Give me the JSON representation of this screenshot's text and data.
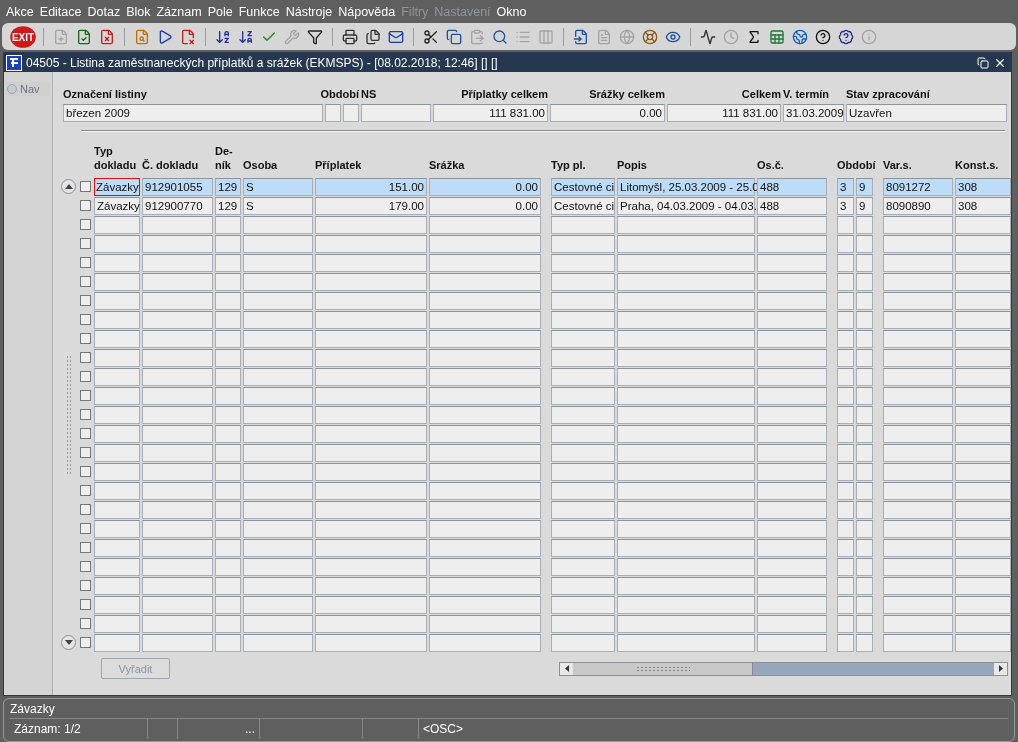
{
  "menu": [
    {
      "label": "Akce",
      "disabled": false
    },
    {
      "label": "Editace",
      "disabled": false
    },
    {
      "label": "Dotaz",
      "disabled": false
    },
    {
      "label": "Blok",
      "disabled": false
    },
    {
      "label": "Záznam",
      "disabled": false
    },
    {
      "label": "Pole",
      "disabled": false
    },
    {
      "label": "Funkce",
      "disabled": false
    },
    {
      "label": "Nástroje",
      "disabled": false
    },
    {
      "label": "Nápověda",
      "disabled": false
    },
    {
      "label": "Filtry",
      "disabled": true
    },
    {
      "label": "Nastavení",
      "disabled": true
    },
    {
      "label": "Okno",
      "disabled": false
    }
  ],
  "toolbar": [
    {
      "kind": "exit",
      "label": "EXIT",
      "disabled": false
    },
    {
      "kind": "separator"
    },
    {
      "kind": "insert",
      "disabled": true
    },
    {
      "kind": "save",
      "disabled": false
    },
    {
      "kind": "delete",
      "disabled": false
    },
    {
      "kind": "separator"
    },
    {
      "kind": "query",
      "disabled": false
    },
    {
      "kind": "run",
      "disabled": false
    },
    {
      "kind": "cancel",
      "disabled": false
    },
    {
      "kind": "separator"
    },
    {
      "kind": "sort-asc",
      "disabled": false
    },
    {
      "kind": "sort-desc",
      "disabled": false
    },
    {
      "kind": "check",
      "disabled": false
    },
    {
      "kind": "wrench",
      "disabled": true
    },
    {
      "kind": "filter",
      "disabled": false
    },
    {
      "kind": "separator"
    },
    {
      "kind": "print",
      "disabled": false
    },
    {
      "kind": "print-all",
      "disabled": false
    },
    {
      "kind": "mail",
      "disabled": false
    },
    {
      "kind": "separator"
    },
    {
      "kind": "cut",
      "disabled": false
    },
    {
      "kind": "copy",
      "disabled": false
    },
    {
      "kind": "paste",
      "disabled": true
    },
    {
      "kind": "find",
      "disabled": false
    },
    {
      "kind": "list",
      "disabled": true
    },
    {
      "kind": "columns",
      "disabled": true
    },
    {
      "kind": "separator"
    },
    {
      "kind": "import",
      "disabled": false
    },
    {
      "kind": "document",
      "disabled": true
    },
    {
      "kind": "globe",
      "disabled": true
    },
    {
      "kind": "wheel",
      "disabled": false
    },
    {
      "kind": "eye",
      "disabled": false
    },
    {
      "kind": "separator"
    },
    {
      "kind": "chart",
      "disabled": false
    },
    {
      "kind": "clock",
      "disabled": true
    },
    {
      "kind": "sigma",
      "disabled": false
    },
    {
      "kind": "sheet",
      "disabled": false
    },
    {
      "kind": "browser",
      "disabled": false
    },
    {
      "kind": "help",
      "disabled": false
    },
    {
      "kind": "help-box",
      "disabled": false
    },
    {
      "kind": "info",
      "disabled": true
    }
  ],
  "window": {
    "title": "04505 - Listina zaměstnaneckých příplatků a srážek (EKMSPS) - [08.02.2018; 12:46] [] []"
  },
  "nav": {
    "label": "Nav",
    "selected": false
  },
  "header": {
    "labels": [
      "Označení listiny",
      "Období",
      "NS",
      "Příplatky celkem",
      "Srážky celkem",
      "Celkem",
      "V. termín",
      "Stav zpracování"
    ],
    "fields": [
      {
        "value": "březen 2009"
      },
      {
        "value": "111 831.00"
      },
      {
        "value": "0.00"
      },
      {
        "value": "111 831.00"
      },
      {
        "value": "31.03.2009"
      },
      {
        "value": "Uzavřen"
      }
    ]
  },
  "table": {
    "columns": [
      "Typ dokladu",
      "Č. dokladu",
      "De-ník",
      "Osoba",
      "Příplatek",
      "Srážka",
      "Typ pl.",
      "Popis",
      "Os.č.",
      "Období",
      "",
      "Var.s.",
      "Konst.s."
    ],
    "rows": [
      {
        "selected": true,
        "focused": true,
        "checked": false,
        "cells": [
          "Závazky",
          "912901055",
          "129",
          "S",
          "151.00",
          "0.00",
          "Cestovné ci",
          "Litomyšl, 25.03.2009 - 25.0",
          "488",
          "3",
          "9",
          "8091272",
          "308"
        ]
      },
      {
        "selected": false,
        "focused": false,
        "checked": false,
        "cells": [
          "Závazky",
          "912900770",
          "129",
          "S",
          "179.00",
          "0.00",
          "Cestovné ci",
          "Praha, 04.03.2009 - 04.03.",
          "488",
          "3",
          "9",
          "8090890",
          "308"
        ]
      },
      {
        "selected": false,
        "checked": false
      },
      {
        "selected": false,
        "checked": false
      },
      {
        "selected": false,
        "checked": false
      },
      {
        "selected": false,
        "checked": false
      },
      {
        "selected": false,
        "checked": false
      },
      {
        "selected": false,
        "checked": false
      },
      {
        "selected": false,
        "checked": false
      },
      {
        "selected": false,
        "checked": false
      },
      {
        "selected": false,
        "checked": false
      },
      {
        "selected": false,
        "checked": false
      },
      {
        "selected": false,
        "checked": false
      },
      {
        "selected": false,
        "checked": false
      },
      {
        "selected": false,
        "checked": false
      },
      {
        "selected": false,
        "checked": false
      },
      {
        "selected": false,
        "checked": false
      },
      {
        "selected": false,
        "checked": false
      },
      {
        "selected": false,
        "checked": false
      },
      {
        "selected": false,
        "checked": false
      },
      {
        "selected": false,
        "checked": false
      },
      {
        "selected": false,
        "checked": false
      },
      {
        "selected": false,
        "checked": false
      },
      {
        "selected": false,
        "checked": false
      },
      {
        "selected": false,
        "checked": false
      }
    ]
  },
  "buttons": [
    {
      "label": "Vyřadit",
      "disabled": true
    }
  ],
  "status_bar": {
    "message": "Závazky",
    "record": "Záznam: 1/2",
    "ellipsis": "...",
    "mode": "<OSC>"
  }
}
